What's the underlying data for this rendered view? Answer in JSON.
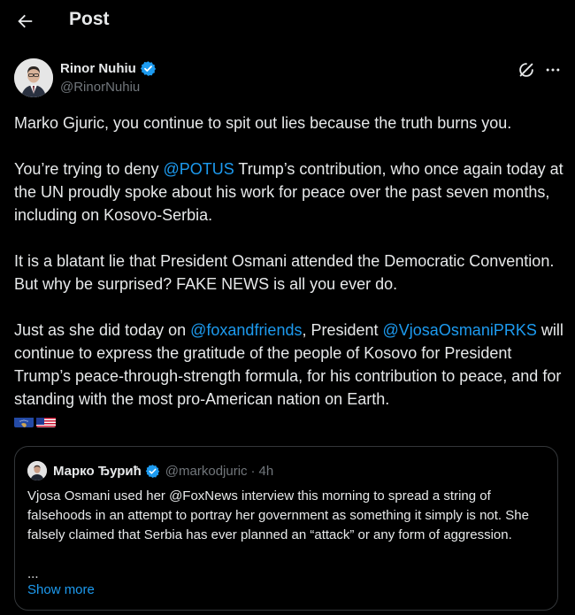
{
  "header": {
    "title": "Post"
  },
  "author": {
    "name": "Rinor Nuhiu",
    "handle": "@RinorNuhiu"
  },
  "post": {
    "p1": "Marko Gjuric, you continue to spit out lies because the truth burns you.",
    "p2_pre": "You’re trying to deny ",
    "p2_mention": "@POTUS",
    "p2_post": " Trump’s contribution, who once again today at the UN proudly spoke about his work for peace over the past seven months, including on Kosovo-Serbia.",
    "p3": "It is a blatant lie that President Osmani attended the Democratic Convention. But why be surprised? FAKE NEWS is all you ever do.",
    "p4_pre": "Just as she did today on ",
    "p4_mention1": "@foxandfriends",
    "p4_mid": ", President ",
    "p4_mention2": "@VjosaOsmaniPRKS",
    "p4_post": " will continue to express the gratitude of the people of Kosovo for President Trump’s peace-through-strength formula, for his contribution to peace, and for standing with the most pro-American nation on Earth.",
    "flags": [
      "kosovo-flag-icon",
      "usa-flag-icon"
    ]
  },
  "quote": {
    "name": "Марко Ђурић",
    "handle": "@markodjuric",
    "dot": "·",
    "time": "4h",
    "text": "Vjosa Osmani used her @FoxNews interview this morning to spread a string of falsehoods in an attempt to portray her government as something it simply is not. She falsely claimed that Serbia has ever planned an “attack” or any form of aggression.",
    "ellipsis": "...",
    "show_more": "Show more"
  },
  "colors": {
    "accent": "#1d9bf0",
    "verified": "#1d9bf0",
    "secondary": "#71767b",
    "background": "#000000",
    "text": "#e7e9ea"
  }
}
